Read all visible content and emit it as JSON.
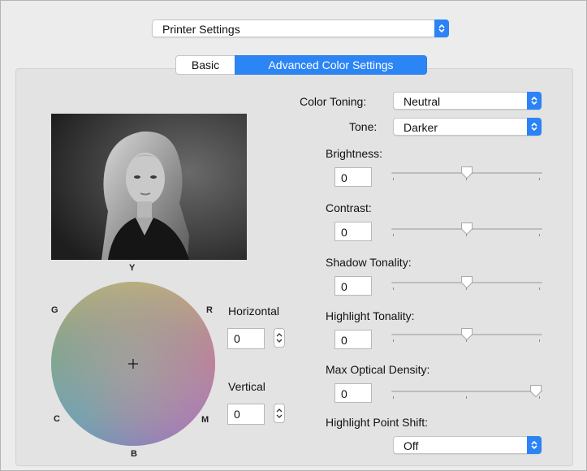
{
  "header": {
    "dropdown_value": "Printer Settings"
  },
  "tabs": {
    "basic": "Basic",
    "advanced": "Advanced Color Settings"
  },
  "color_toning": {
    "label": "Color Toning:",
    "value": "Neutral"
  },
  "tone": {
    "label": "Tone:",
    "value": "Darker"
  },
  "sliders": {
    "brightness": {
      "label": "Brightness:",
      "value": "0",
      "position": 0.5
    },
    "contrast": {
      "label": "Contrast:",
      "value": "0",
      "position": 0.5
    },
    "shadow": {
      "label": "Shadow Tonality:",
      "value": "0",
      "position": 0.5
    },
    "highlight": {
      "label": "Highlight Tonality:",
      "value": "0",
      "position": 0.5
    },
    "max_density": {
      "label": "Max Optical Density:",
      "value": "0",
      "position": 1.0
    }
  },
  "highlight_point_shift": {
    "label": "Highlight Point Shift:",
    "value": "Off"
  },
  "color_wheel": {
    "top": "Y",
    "top_right": "R",
    "bottom_right": "M",
    "bottom": "B",
    "bottom_left": "C",
    "top_left": "G"
  },
  "horizontal": {
    "label": "Horizontal",
    "value": "0"
  },
  "vertical": {
    "label": "Vertical",
    "value": "0"
  },
  "colors": {
    "accent": "#2b83f6",
    "panel": "#ececec",
    "group": "#e3e3e3"
  }
}
